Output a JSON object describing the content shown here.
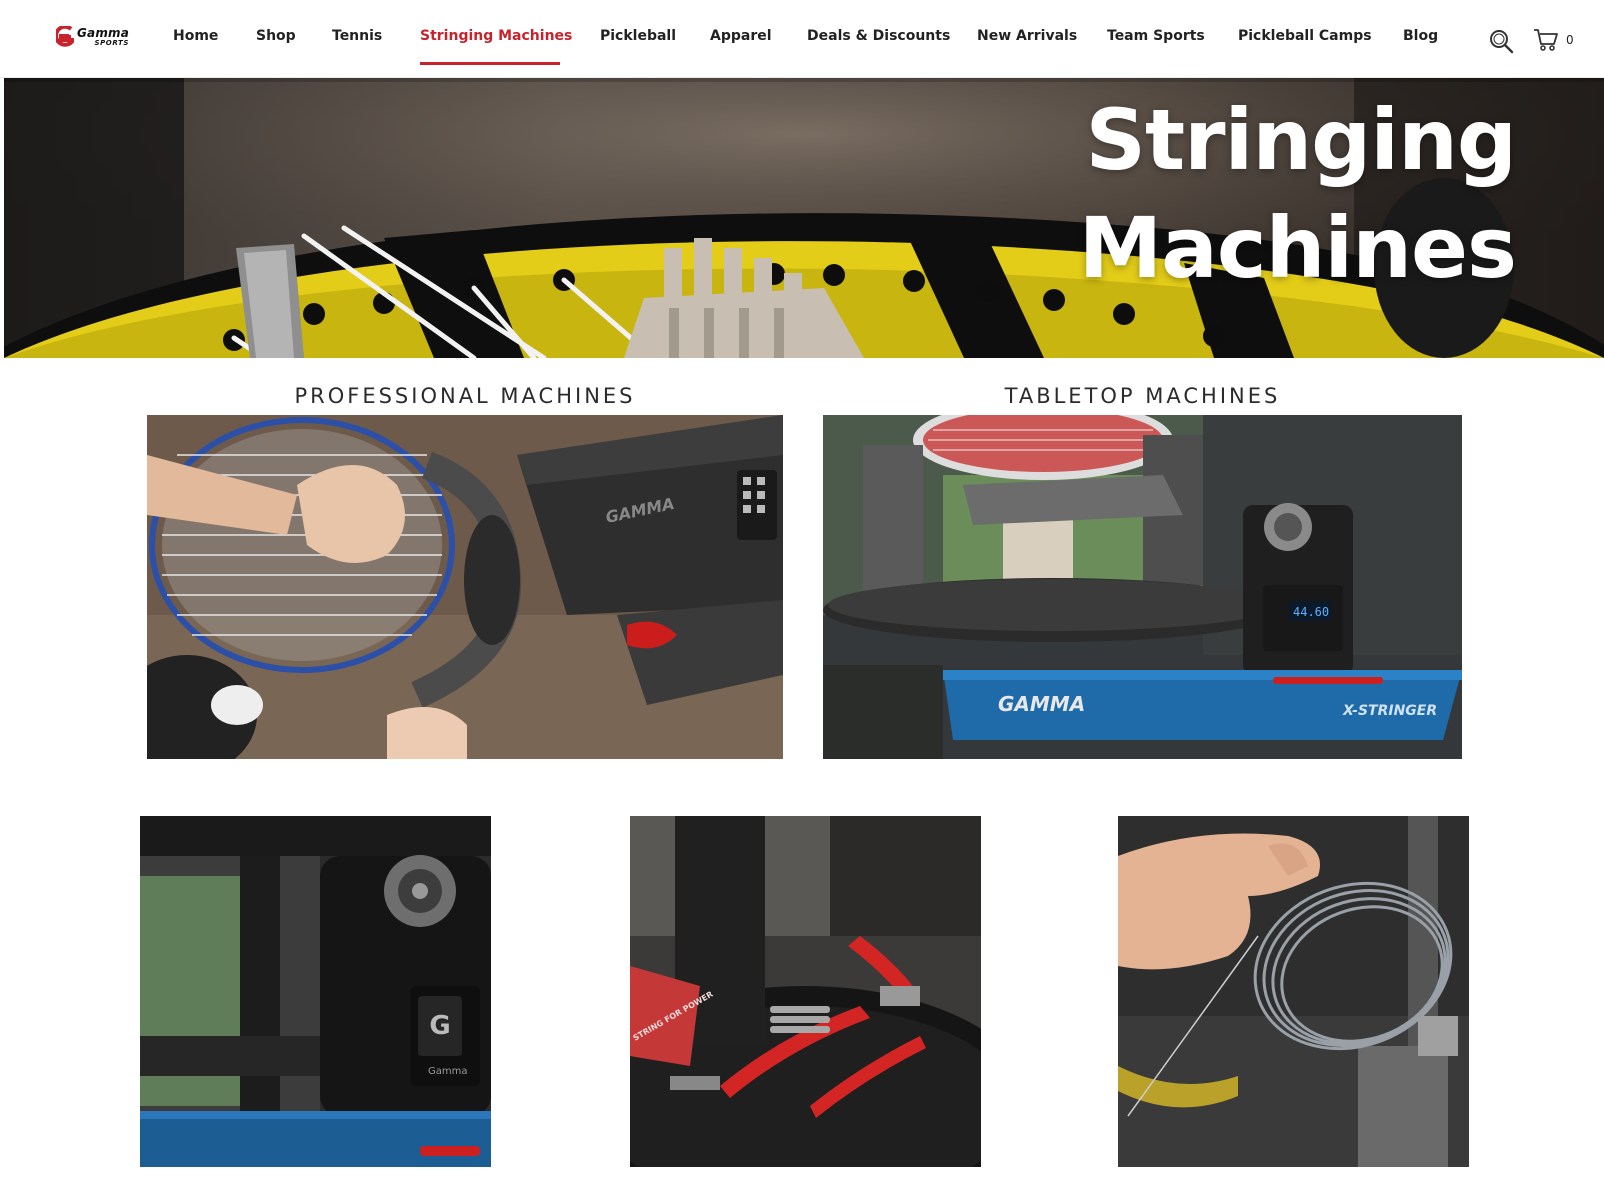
{
  "brand": {
    "name": "Gamma",
    "tagline": "SPORTS",
    "colors": {
      "accent": "#c8232c",
      "text": "#222222"
    }
  },
  "nav": {
    "items": [
      {
        "label": "Home",
        "active": false
      },
      {
        "label": "Shop",
        "active": false
      },
      {
        "label": "Tennis",
        "active": false
      },
      {
        "label": "Stringing Machines",
        "active": true
      },
      {
        "label": "Pickleball",
        "active": false
      },
      {
        "label": "Apparel",
        "active": false
      },
      {
        "label": "Deals & Discounts",
        "active": false
      },
      {
        "label": "New Arrivals",
        "active": false
      },
      {
        "label": "Team Sports",
        "active": false
      },
      {
        "label": "Pickleball Camps",
        "active": false
      },
      {
        "label": "Blog",
        "active": false
      }
    ],
    "search_icon": "search-icon",
    "cart_icon": "cart-icon",
    "cart_count": "0"
  },
  "hero": {
    "title_line1": "Stringing",
    "title_line2": "Machines"
  },
  "categories": [
    {
      "heading": "PROFESSIONAL MACHINES",
      "image_machine_label": "GAMMA"
    },
    {
      "heading": "TABLETOP MACHINES",
      "image_brand": "GAMMA",
      "image_product": "X-STRINGER",
      "image_display": "44.60"
    }
  ],
  "gallery": [
    {
      "image_label": "Gamma"
    },
    {
      "image_label": "STRING FOR POWER"
    },
    {
      "image_label": ""
    }
  ]
}
